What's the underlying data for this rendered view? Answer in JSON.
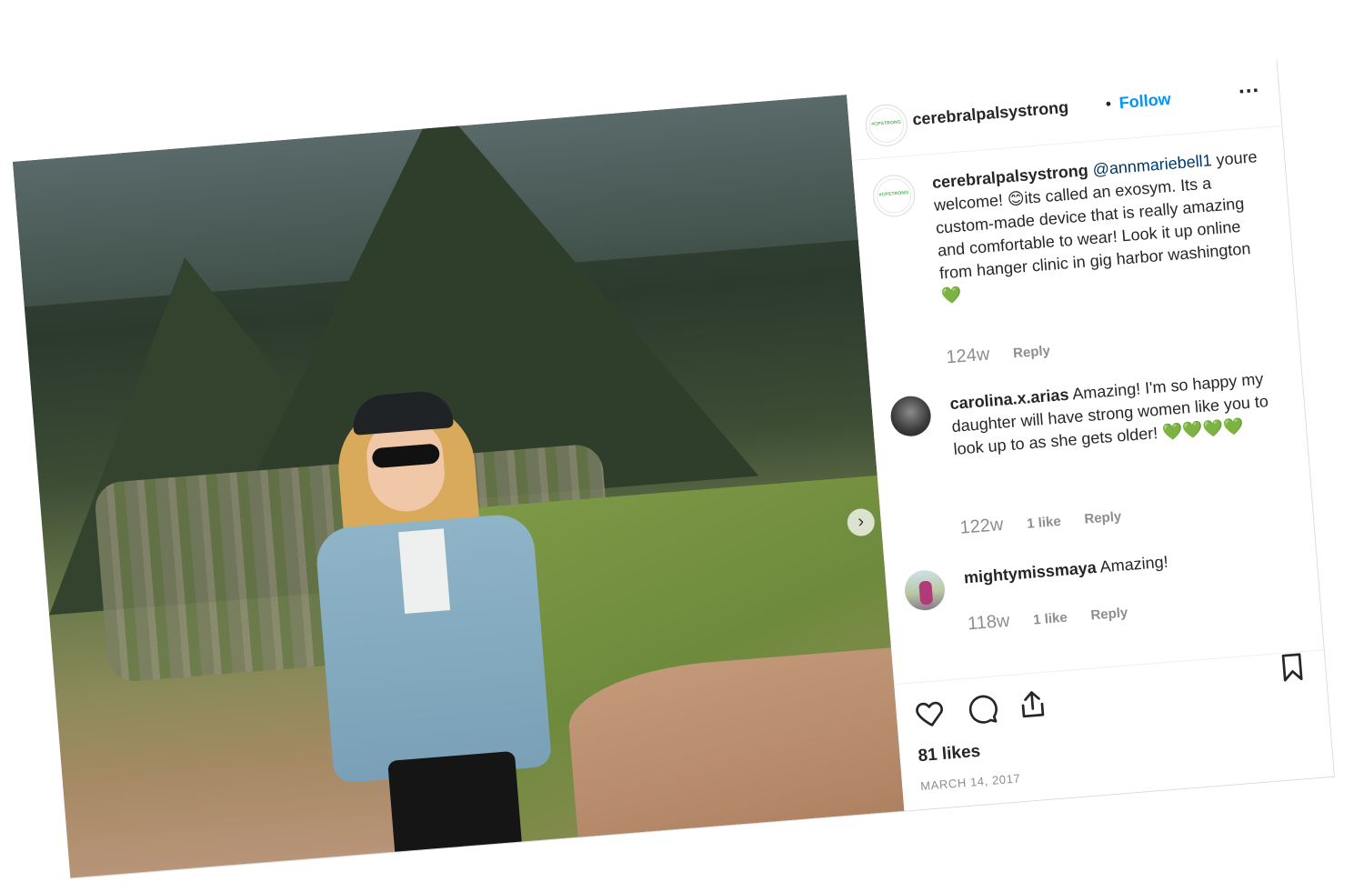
{
  "post": {
    "username": "cerebralpalsystrong",
    "separator": "•",
    "follow_label": "Follow",
    "more_label": "...",
    "avatar_text": "#CPSTRONG",
    "photo_next_label": "›"
  },
  "comments": [
    {
      "username": "cerebralpalsystrong",
      "mention": "@annmariebell1",
      "text": "youre welcome! 😊its called an exosym. Its a custom-made device that is really amazing and comfortable to wear! Look it up online from hanger clinic in gig harbor washington 💚",
      "time": "124w",
      "likes": "",
      "reply_label": "Reply"
    },
    {
      "username": "carolina.x.arias",
      "text": "Amazing! I'm so happy my daughter will have strong women like you to look up to as she gets older! 💚💚💚💚",
      "time": "122w",
      "likes": "1 like",
      "reply_label": "Reply"
    },
    {
      "username": "mightymissmaya",
      "text": "Amazing!",
      "time": "118w",
      "likes": "1 like",
      "reply_label": "Reply"
    }
  ],
  "footer": {
    "likes_count": "81 likes",
    "date": "MARCH 14, 2017"
  },
  "icons": [
    "heart-icon",
    "comment-icon",
    "share-icon",
    "bookmark-icon"
  ],
  "colors": {
    "follow": "#0095f6",
    "text": "#262626",
    "muted": "#8e8e8e",
    "mention": "#00376b"
  }
}
